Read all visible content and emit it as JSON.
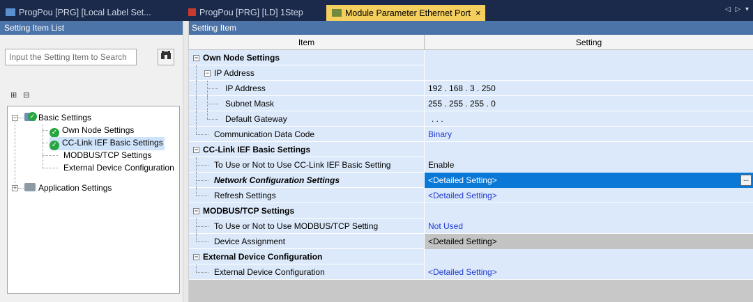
{
  "tabs": [
    {
      "label": "ProgPou [PRG] [Local Label Set...",
      "active": false
    },
    {
      "label": "ProgPou [PRG] [LD] 1Step",
      "active": false
    },
    {
      "label": "Module Parameter Ethernet Port",
      "active": true
    }
  ],
  "tab_close": "×",
  "tab_nav": "◁ ▷ ▾",
  "left": {
    "title": "Setting Item List",
    "search_placeholder": "Input the Setting Item to Search",
    "tree": {
      "basic": "Basic Settings",
      "own_node": "Own Node Settings",
      "cclink": "CC-Link IEF Basic Settings",
      "modbus": "MODBUS/TCP Settings",
      "external": "External Device Configuration",
      "application": "Application Settings"
    }
  },
  "right": {
    "title": "Setting Item",
    "col_item": "Item",
    "col_setting": "Setting",
    "rows": {
      "own_node": {
        "item": "Own Node Settings",
        "setting": ""
      },
      "ip_group": {
        "item": "IP Address",
        "setting": ""
      },
      "ip": {
        "item": "IP Address",
        "setting": "192 . 168 .   3 . 250"
      },
      "subnet": {
        "item": "Subnet Mask",
        "setting": "255 . 255 . 255 .   0"
      },
      "gateway": {
        "item": "Default Gateway",
        "setting": ".       .       ."
      },
      "comm_code": {
        "item": "Communication Data Code",
        "setting": "Binary"
      },
      "cclink": {
        "item": "CC-Link IEF Basic Settings",
        "setting": ""
      },
      "cclink_use": {
        "item": "To Use or Not to Use CC-Link IEF Basic Setting",
        "setting": "Enable"
      },
      "netconf": {
        "item": "Network Configuration Settings",
        "setting": "<Detailed Setting>"
      },
      "refresh": {
        "item": "Refresh Settings",
        "setting": "<Detailed Setting>"
      },
      "modbus": {
        "item": "MODBUS/TCP Settings",
        "setting": ""
      },
      "modbus_use": {
        "item": "To Use or Not to Use MODBUS/TCP Setting",
        "setting": "Not Used"
      },
      "device": {
        "item": "Device Assignment",
        "setting": "<Detailed Setting>"
      },
      "extdev": {
        "item": "External Device Configuration",
        "setting": ""
      },
      "extdev_item": {
        "item": "External Device Configuration",
        "setting": "<Detailed Setting>"
      }
    }
  },
  "ellipsis": "...",
  "colors": {
    "header_blue": "#4c74a8",
    "row_blue": "#dce9fa",
    "selected": "#0a78d7",
    "active_tab": "#f5cf5e",
    "link_blue": "#1f3ad1",
    "check_green": "#26a541"
  }
}
